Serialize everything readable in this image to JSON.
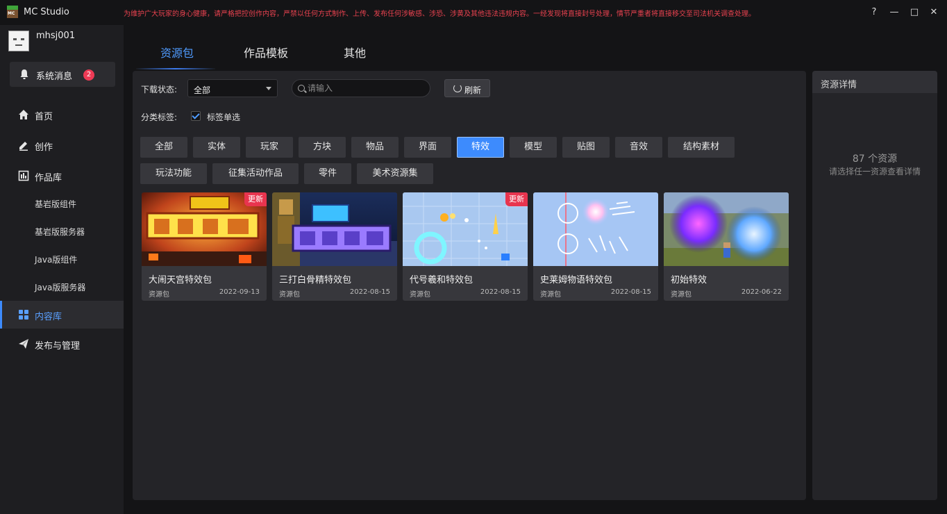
{
  "window": {
    "title": "MC Studio",
    "notice": "为维护广大玩家的身心健康，请严格把控创作内容，严禁以任何方式制作、上传、发布任何涉敏感、涉恐、涉黄及其他违法违规内容。一经发现将直接封号处理，情节严重者将直接移交至司法机关调查处理。",
    "help_glyph": "?",
    "minimize_glyph": "—",
    "maximize_glyph": "□",
    "close_glyph": "✕"
  },
  "user": {
    "name": "mhsj001"
  },
  "sidebar": {
    "system_message_label": "系统消息",
    "system_message_count": "2",
    "items": [
      {
        "label": "首页",
        "icon": "home-icon"
      },
      {
        "label": "创作",
        "icon": "pen-icon"
      },
      {
        "label": "作品库",
        "icon": "library-icon"
      },
      {
        "label": "基岩版组件"
      },
      {
        "label": "基岩版服务器"
      },
      {
        "label": "Java版组件"
      },
      {
        "label": "Java版服务器"
      },
      {
        "label": "内容库",
        "icon": "grid-icon",
        "active": true
      },
      {
        "label": "发布与管理",
        "icon": "send-icon"
      }
    ]
  },
  "main_tabs": [
    {
      "label": "资源包",
      "active": true
    },
    {
      "label": "作品模板"
    },
    {
      "label": "其他"
    }
  ],
  "filters": {
    "download_status_label": "下载状态:",
    "download_status_value": "全部",
    "search_placeholder": "请输入",
    "refresh_label": "刷新",
    "category_label": "分类标签:",
    "single_select_label": "标签单选"
  },
  "tags": [
    {
      "label": "全部"
    },
    {
      "label": "实体"
    },
    {
      "label": "玩家"
    },
    {
      "label": "方块"
    },
    {
      "label": "物品"
    },
    {
      "label": "界面"
    },
    {
      "label": "特效",
      "active": true
    },
    {
      "label": "模型"
    },
    {
      "label": "贴图"
    },
    {
      "label": "音效"
    },
    {
      "label": "结构素材"
    },
    {
      "label": "玩法功能"
    },
    {
      "label": "征集活动作品"
    },
    {
      "label": "零件"
    },
    {
      "label": "美术资源集"
    }
  ],
  "cards": [
    {
      "name": "大闹天宫特效包",
      "type": "资源包",
      "date": "2022-09-13",
      "badge": "更新"
    },
    {
      "name": "三打白骨精特效包",
      "type": "资源包",
      "date": "2022-08-15"
    },
    {
      "name": "代号羲和特效包",
      "type": "资源包",
      "date": "2022-08-15",
      "badge": "更新"
    },
    {
      "name": "史莱姆物语特效包",
      "type": "资源包",
      "date": "2022-08-15"
    },
    {
      "name": "初始特效",
      "type": "资源包",
      "date": "2022-06-22"
    }
  ],
  "detail": {
    "title": "资源详情",
    "count": "87 个资源",
    "hint": "请选择任一资源查看详情"
  }
}
